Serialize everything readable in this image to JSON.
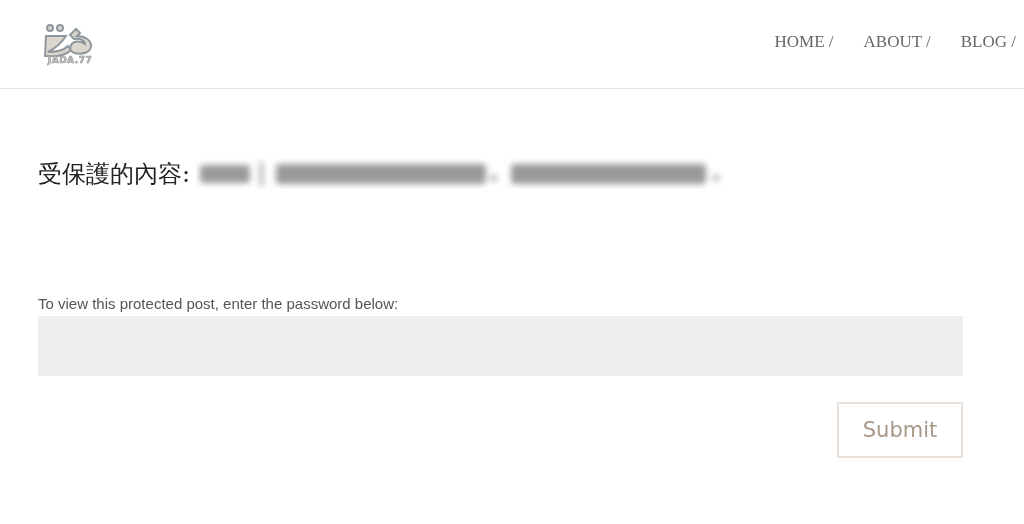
{
  "logo": {
    "text": "JADA.77"
  },
  "nav": [
    "HOME /",
    "ABOUT /",
    "BLOG /"
  ],
  "title": {
    "prefix": "受保護的內容:",
    "rest": {
      "kind": "blurred"
    }
  },
  "form": {
    "label": "To view this protected post, enter the password below:",
    "submit": "Submit"
  }
}
